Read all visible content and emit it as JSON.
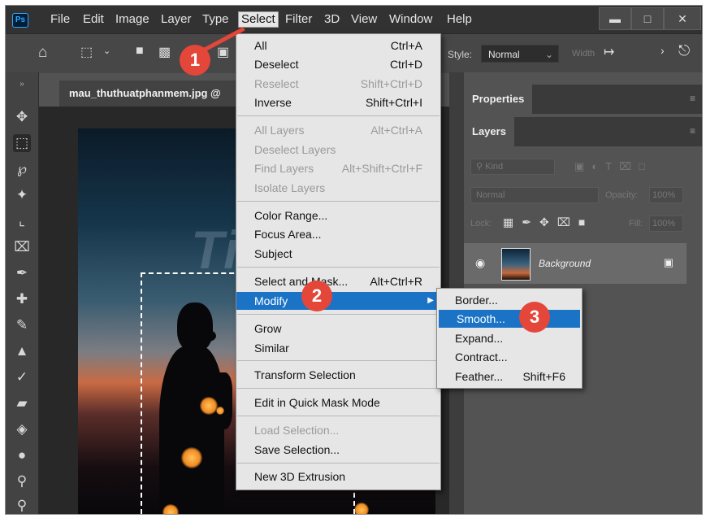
{
  "menubar": {
    "logo": "Ps",
    "items": [
      "File",
      "Edit",
      "Image",
      "Layer",
      "Type",
      "Select",
      "Filter",
      "3D",
      "View",
      "Window",
      "Help"
    ],
    "active": "Select"
  },
  "options": {
    "style_label": "Style:",
    "style_value": "Normal",
    "width_label": "Width"
  },
  "document": {
    "tab_title": "mau_thuthuatphanmem.jpg @"
  },
  "watermark": "TipsMake",
  "panels": {
    "properties_tab": "Properties",
    "layers_tab": "Layers",
    "kind_label": "Kind",
    "blend_mode": "Normal",
    "opacity_label": "Opacity:",
    "opacity_value": "100%",
    "lock_label": "Lock:",
    "fill_label": "Fill:",
    "fill_value": "100%",
    "layer_name": "Background"
  },
  "select_menu": {
    "items": [
      {
        "label": "All",
        "shortcut": "Ctrl+A"
      },
      {
        "label": "Deselect",
        "shortcut": "Ctrl+D"
      },
      {
        "label": "Reselect",
        "shortcut": "Shift+Ctrl+D",
        "disabled": true
      },
      {
        "label": "Inverse",
        "shortcut": "Shift+Ctrl+I"
      },
      {
        "label": "All Layers",
        "shortcut": "Alt+Ctrl+A",
        "disabled": true
      },
      {
        "label": "Deselect Layers",
        "shortcut": "",
        "disabled": true
      },
      {
        "label": "Find Layers",
        "shortcut": "Alt+Shift+Ctrl+F",
        "disabled": true
      },
      {
        "label": "Isolate Layers",
        "shortcut": "",
        "disabled": true
      },
      {
        "label": "Color Range...",
        "shortcut": ""
      },
      {
        "label": "Focus Area...",
        "shortcut": ""
      },
      {
        "label": "Subject",
        "shortcut": ""
      },
      {
        "label": "Select and Mask...",
        "shortcut": "Alt+Ctrl+R"
      },
      {
        "label": "Modify",
        "shortcut": "",
        "highlighted": true
      },
      {
        "label": "Grow",
        "shortcut": ""
      },
      {
        "label": "Similar",
        "shortcut": ""
      },
      {
        "label": "Transform Selection",
        "shortcut": ""
      },
      {
        "label": "Edit in Quick Mask Mode",
        "shortcut": ""
      },
      {
        "label": "Load Selection...",
        "shortcut": "",
        "disabled": true
      },
      {
        "label": "Save Selection...",
        "shortcut": ""
      },
      {
        "label": "New 3D Extrusion",
        "shortcut": ""
      }
    ]
  },
  "modify_submenu": {
    "items": [
      {
        "label": "Border...",
        "shortcut": ""
      },
      {
        "label": "Smooth...",
        "shortcut": "",
        "highlighted": true
      },
      {
        "label": "Expand...",
        "shortcut": ""
      },
      {
        "label": "Contract...",
        "shortcut": ""
      },
      {
        "label": "Feather...",
        "shortcut": "Shift+F6"
      }
    ]
  },
  "steps": [
    "1",
    "2",
    "3"
  ],
  "colors": {
    "highlight": "#1b73c6",
    "badge": "#e4463a",
    "menu_bg": "#e6e6e6"
  }
}
